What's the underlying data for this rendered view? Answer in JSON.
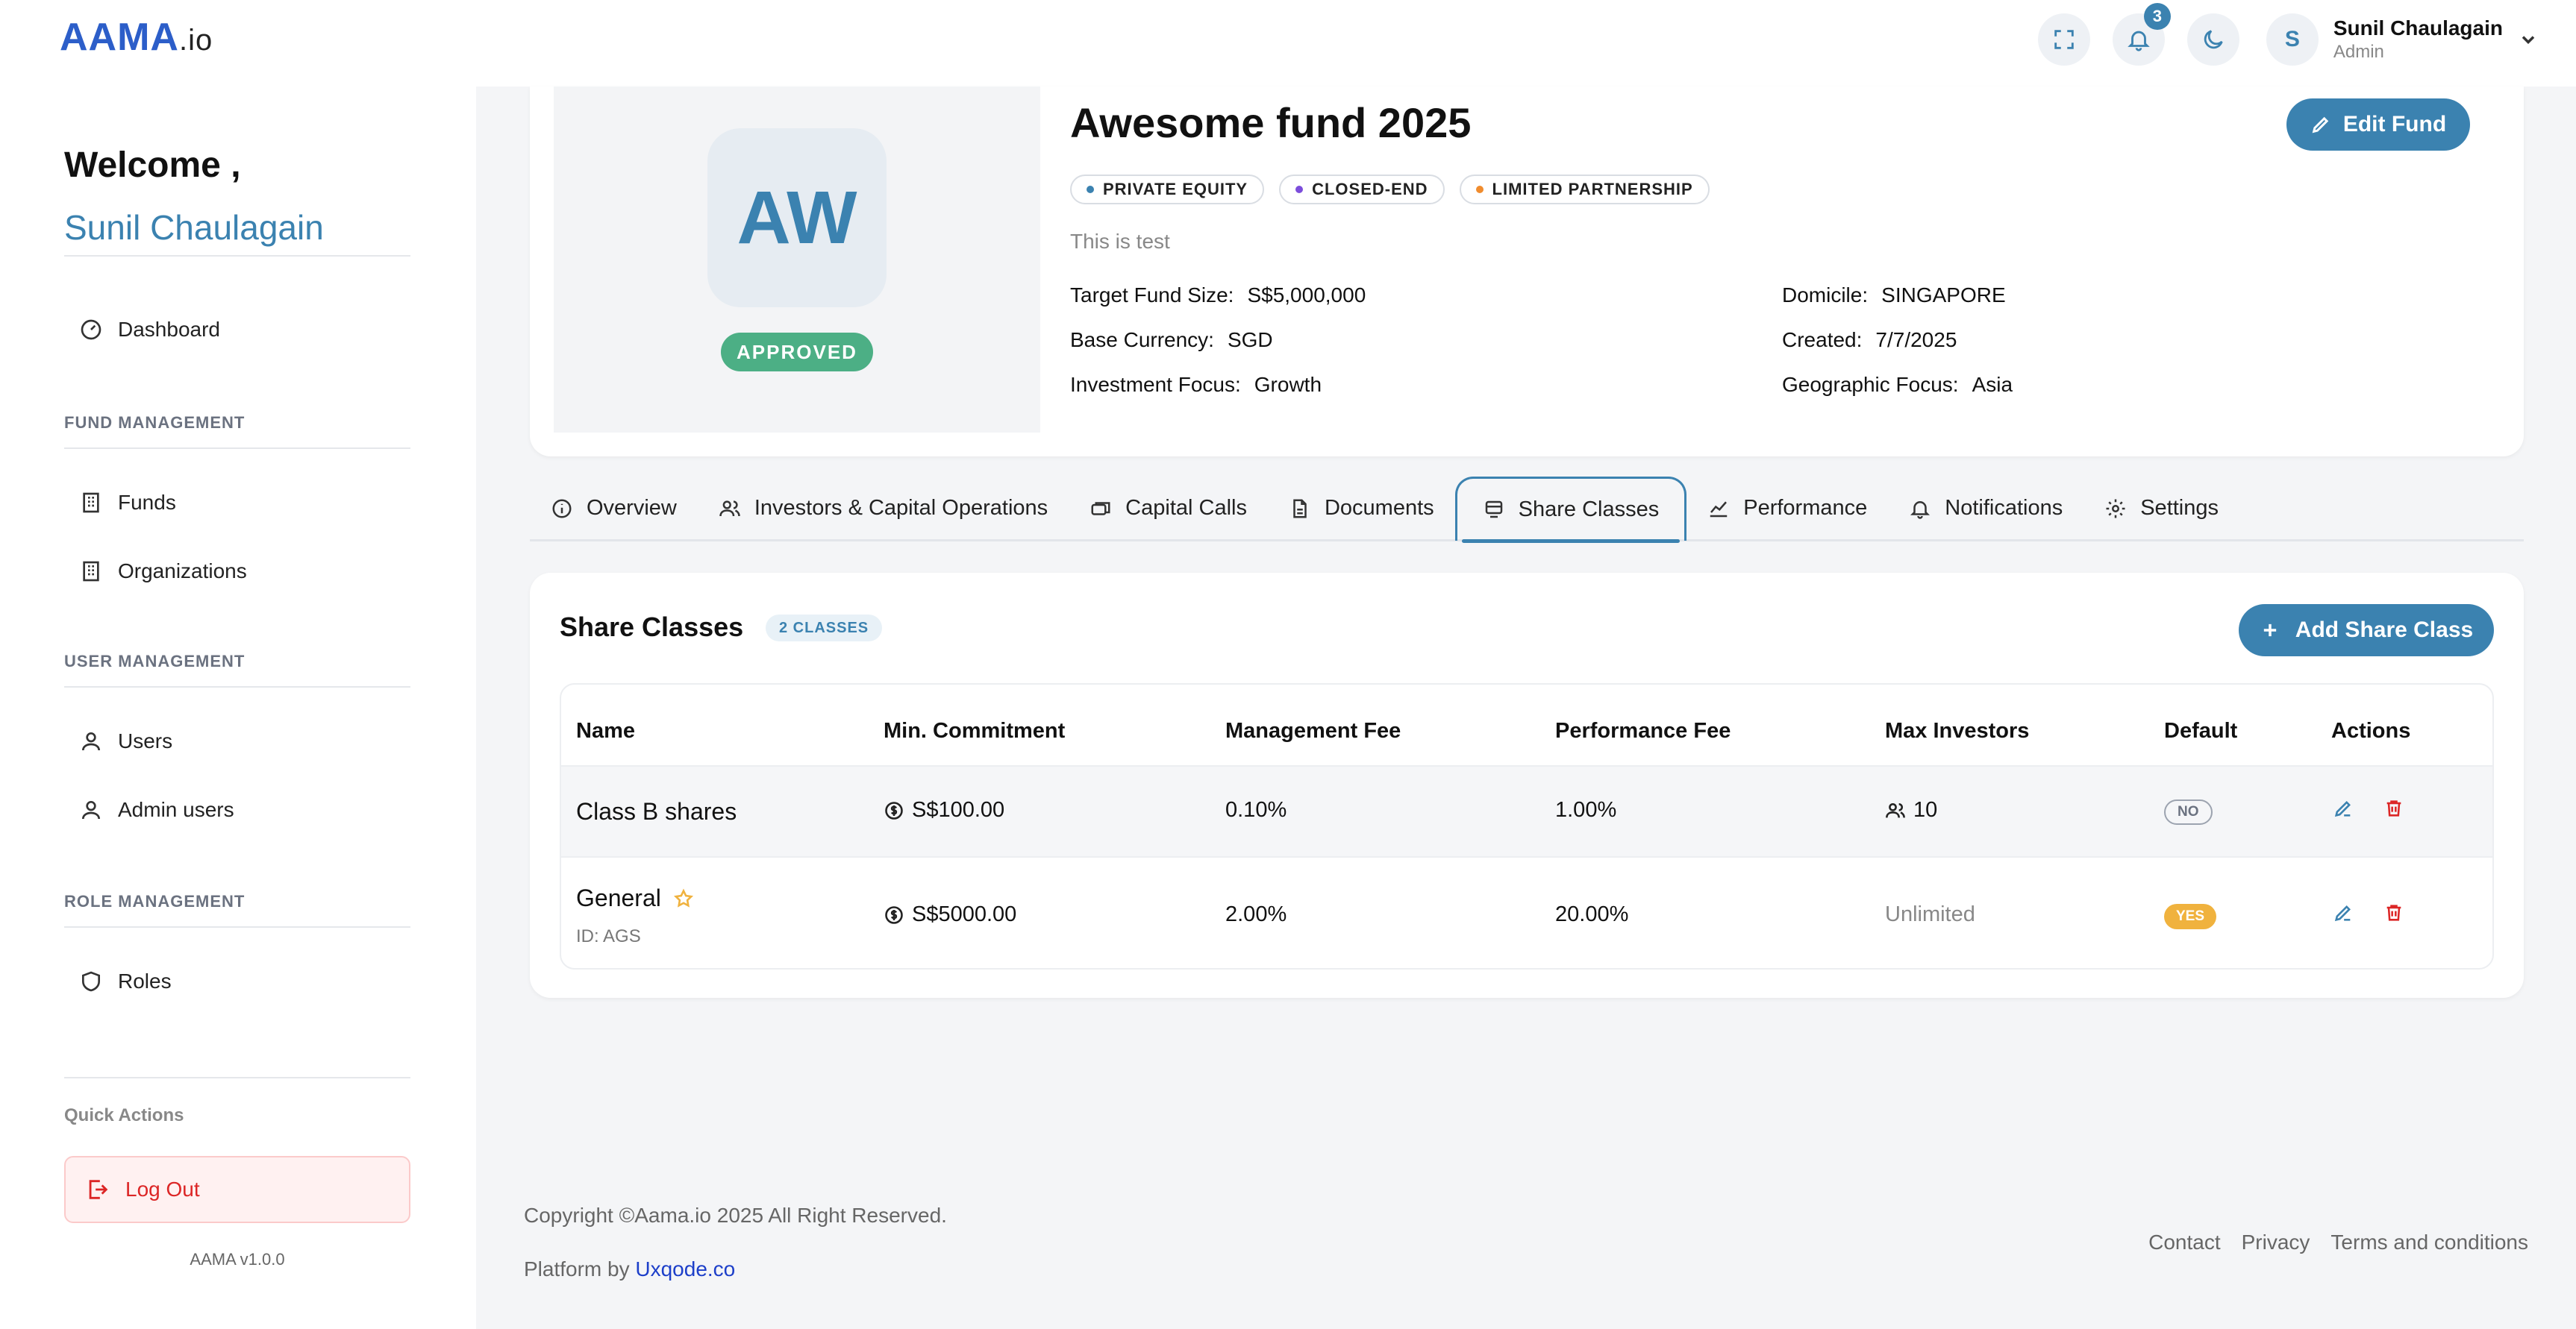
{
  "app": {
    "logo_main": "AAMA",
    "logo_suffix": ".io",
    "notification_count": "3",
    "user_initial": "S",
    "user_name": "Sunil Chaulagain",
    "user_role": "Admin"
  },
  "sidebar": {
    "welcome": "Welcome ,",
    "welcome_name": "Sunil Chaulagain",
    "dashboard": "Dashboard",
    "section_fund": "FUND MANAGEMENT",
    "funds": "Funds",
    "organizations": "Organizations",
    "section_user": "USER MANAGEMENT",
    "users": "Users",
    "admin_users": "Admin users",
    "section_role": "ROLE MANAGEMENT",
    "roles": "Roles",
    "quick_actions": "Quick Actions",
    "logout": "Log Out",
    "version": "AAMA v1.0.0"
  },
  "fund": {
    "initials": "AW",
    "status": "APPROVED",
    "title": "Awesome fund 2025",
    "edit_label": "Edit Fund",
    "tags": [
      {
        "label": "PRIVATE EQUITY",
        "color": "#3b82b0"
      },
      {
        "label": "CLOSED-END",
        "color": "#7c4ddb"
      },
      {
        "label": "LIMITED PARTNERSHIP",
        "color": "#f08c2e"
      }
    ],
    "description": "This is test",
    "target_size_label": "Target Fund Size:",
    "target_size": "S$5,000,000",
    "base_currency_label": "Base Currency:",
    "base_currency": "SGD",
    "investment_focus_label": "Investment Focus:",
    "investment_focus": "Growth",
    "domicile_label": "Domicile:",
    "domicile": "SINGAPORE",
    "created_label": "Created:",
    "created": "7/7/2025",
    "geo_focus_label": "Geographic Focus:",
    "geo_focus": "Asia"
  },
  "tabs": {
    "overview": "Overview",
    "investors": "Investors & Capital Operations",
    "capital_calls": "Capital Calls",
    "documents": "Documents",
    "share_classes": "Share Classes",
    "performance": "Performance",
    "notifications": "Notifications",
    "settings": "Settings"
  },
  "share_classes": {
    "title": "Share Classes",
    "count_badge": "2 CLASSES",
    "add_label": "Add Share Class",
    "columns": {
      "name": "Name",
      "min_commitment": "Min. Commitment",
      "management_fee": "Management Fee",
      "performance_fee": "Performance Fee",
      "max_investors": "Max Investors",
      "default": "Default",
      "actions": "Actions"
    },
    "rows": [
      {
        "name": "Class B shares",
        "min_commitment": "S$100.00",
        "management_fee": "0.10%",
        "performance_fee": "1.00%",
        "max_investors": "10",
        "default": "NO"
      },
      {
        "name": "General",
        "id": "ID: AGS",
        "min_commitment": "S$5000.00",
        "management_fee": "2.00%",
        "performance_fee": "20.00%",
        "max_investors": "Unlimited",
        "default": "YES"
      }
    ]
  },
  "footer": {
    "copyright": "Copyright ©Aama.io 2025 All Right Reserved.",
    "platform_prefix": "Platform by ",
    "platform_link": "Uxqode.co",
    "contact": "Contact",
    "privacy": "Privacy",
    "terms": "Terms and conditions"
  }
}
